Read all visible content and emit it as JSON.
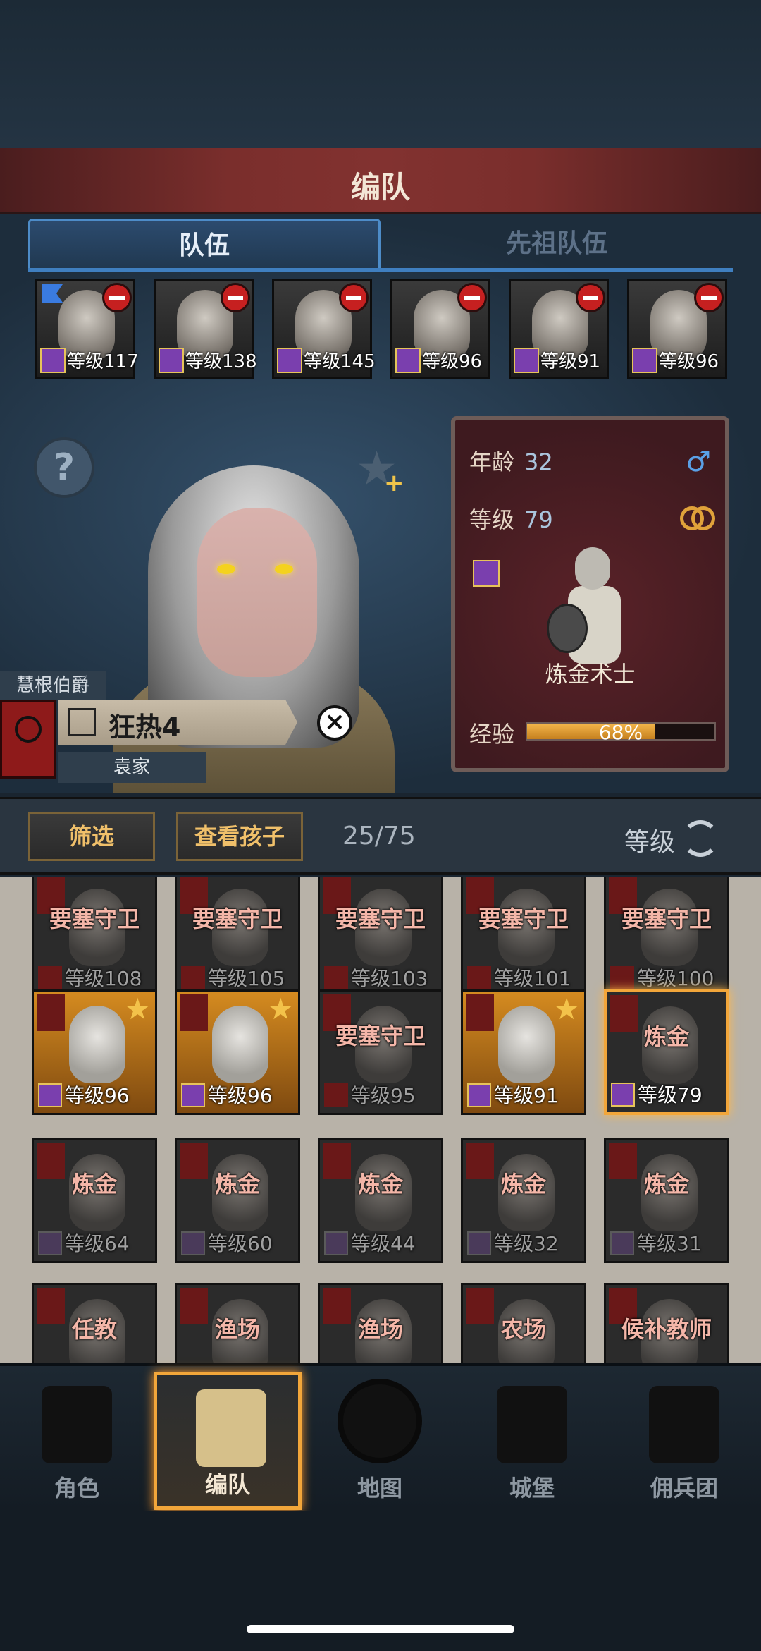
{
  "header": {
    "title": "编队"
  },
  "tabs": [
    {
      "label": "队伍",
      "active": true
    },
    {
      "label": "先祖队伍",
      "active": false
    }
  ],
  "party": [
    {
      "level": "等级117",
      "leader": true
    },
    {
      "level": "等级138"
    },
    {
      "level": "等级145"
    },
    {
      "level": "等级96"
    },
    {
      "level": "等级91"
    },
    {
      "level": "等级96"
    }
  ],
  "character": {
    "bearer": "慧根伯爵",
    "trait": "狂热4",
    "house": "袁家",
    "age_label": "年龄",
    "age": "32",
    "level_label": "等级",
    "level": "79",
    "class_name": "炼金术士",
    "exp_label": "经验",
    "exp_percent": 68,
    "exp_text": "68%"
  },
  "filter": {
    "filter_label": "筛选",
    "children_label": "查看孩子",
    "count": "25/75",
    "sort_label": "等级"
  },
  "roster": [
    {
      "job": "要塞守卫",
      "level": "等级108",
      "style": "dim"
    },
    {
      "job": "要塞守卫",
      "level": "等级105",
      "style": "dim"
    },
    {
      "job": "要塞守卫",
      "level": "等级103",
      "style": "dim"
    },
    {
      "job": "要塞守卫",
      "level": "等级101",
      "style": "dim"
    },
    {
      "job": "要塞守卫",
      "level": "等级100",
      "style": "dim"
    },
    {
      "job": "",
      "level": "等级96",
      "style": "gold"
    },
    {
      "job": "",
      "level": "等级96",
      "style": "gold"
    },
    {
      "job": "要塞守卫",
      "level": "等级95",
      "style": "dim"
    },
    {
      "job": "",
      "level": "等级91",
      "style": "gold"
    },
    {
      "job": "炼金",
      "level": "等级79",
      "style": "sel"
    },
    {
      "job": "炼金",
      "level": "等级64",
      "style": "dim"
    },
    {
      "job": "炼金",
      "level": "等级60",
      "style": "dim"
    },
    {
      "job": "炼金",
      "level": "等级44",
      "style": "dim"
    },
    {
      "job": "炼金",
      "level": "等级32",
      "style": "dim"
    },
    {
      "job": "炼金",
      "level": "等级31",
      "style": "dim"
    },
    {
      "job": "任教",
      "level": "",
      "style": "dim"
    },
    {
      "job": "渔场",
      "level": "",
      "style": "dim"
    },
    {
      "job": "渔场",
      "level": "",
      "style": "dim"
    },
    {
      "job": "农场",
      "level": "",
      "style": "dim"
    },
    {
      "job": "候补教师",
      "level": "",
      "style": "dim"
    }
  ],
  "nav": [
    {
      "label": "角色",
      "icon": "knight-icon"
    },
    {
      "label": "编队",
      "icon": "helmet-icon",
      "active": true
    },
    {
      "label": "地图",
      "icon": "compass-icon"
    },
    {
      "label": "城堡",
      "icon": "castle-icon"
    },
    {
      "label": "佣兵团",
      "icon": "mercenary-icon"
    }
  ]
}
